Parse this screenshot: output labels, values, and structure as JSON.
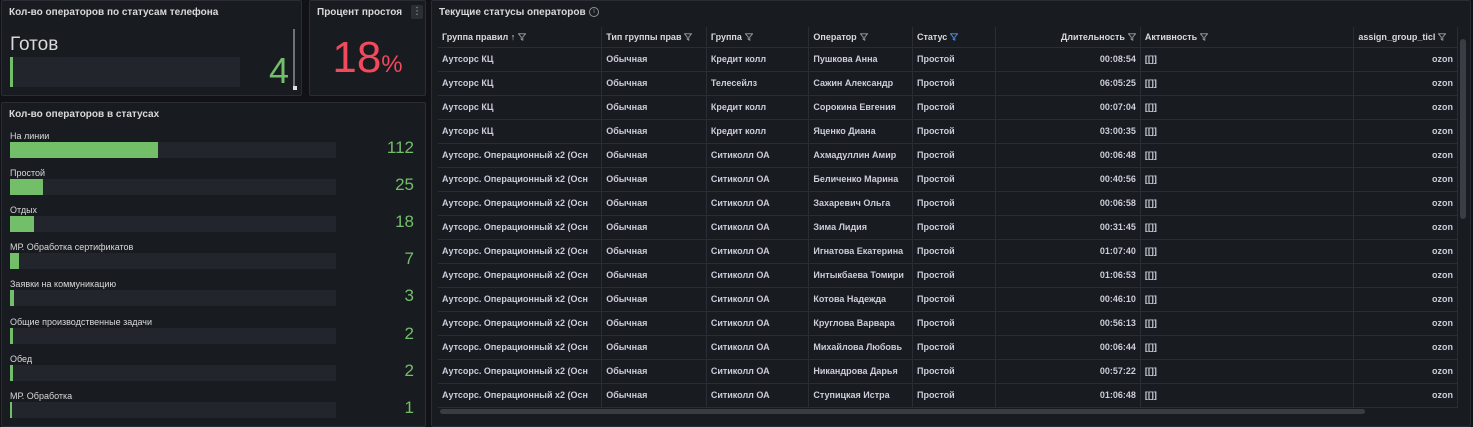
{
  "panel_phone_status": {
    "title": "Кол-во операторов по статусам телефона",
    "state": "Готов",
    "value": "4",
    "fill_fraction": 0.013
  },
  "panel_idle_percent": {
    "title": "Процент простоя",
    "value": "18",
    "unit": "%",
    "menu_icon": "⋮"
  },
  "panel_statuses": {
    "title": "Кол-во операторов в статусах",
    "max": 112,
    "items": [
      {
        "label": "На линии",
        "value": 112
      },
      {
        "label": "Простой",
        "value": 25
      },
      {
        "label": "Отдых",
        "value": 18
      },
      {
        "label": "МР. Обработка сертификатов",
        "value": 7
      },
      {
        "label": "Заявки на коммуникацию",
        "value": 3
      },
      {
        "label": "Общие производственные задачи",
        "value": 2
      },
      {
        "label": "Обед",
        "value": 2
      },
      {
        "label": "МР. Обработка",
        "value": 1
      }
    ]
  },
  "panel_table": {
    "title": "Текущие статусы операторов",
    "info_icon": "i",
    "sort_icon": "↑",
    "columns": [
      {
        "label": "Группа правил",
        "sorted": true
      },
      {
        "label": "Тип группы прав"
      },
      {
        "label": "Группа"
      },
      {
        "label": "Оператор"
      },
      {
        "label": "Статус",
        "filter_active": true
      },
      {
        "label": "Длительность"
      },
      {
        "label": "Активность"
      },
      {
        "label": "assign_group_ticl"
      }
    ],
    "rows": [
      [
        "Аутсорс КЦ",
        "Обычная",
        "Кредит колл",
        "Пушкова Анна",
        "Простой",
        "00:08:54",
        "[[]]",
        "ozon"
      ],
      [
        "Аутсорс КЦ",
        "Обычная",
        "Телесейлз",
        "Сажин Александр",
        "Простой",
        "06:05:25",
        "[[]]",
        "ozon"
      ],
      [
        "Аутсорс КЦ",
        "Обычная",
        "Кредит колл",
        "Сорокина Евгения",
        "Простой",
        "00:07:04",
        "[[]]",
        "ozon"
      ],
      [
        "Аутсорс КЦ",
        "Обычная",
        "Кредит колл",
        "Яценко Диана",
        "Простой",
        "03:00:35",
        "[[]]",
        "ozon"
      ],
      [
        "Аутсорс. Операционный x2 (Осн",
        "Обычная",
        "Ситиколл ОА",
        "Ахмадуллин Амир",
        "Простой",
        "00:06:48",
        "[[]]",
        "ozon"
      ],
      [
        "Аутсорс. Операционный x2 (Осн",
        "Обычная",
        "Ситиколл ОА",
        "Беличенко Марина",
        "Простой",
        "00:40:56",
        "[[]]",
        "ozon"
      ],
      [
        "Аутсорс. Операционный x2 (Осн",
        "Обычная",
        "Ситиколл ОА",
        "Захаревич Ольга",
        "Простой",
        "00:06:58",
        "[[]]",
        "ozon"
      ],
      [
        "Аутсорс. Операционный x2 (Осн",
        "Обычная",
        "Ситиколл ОА",
        "Зима Лидия",
        "Простой",
        "00:31:45",
        "[[]]",
        "ozon"
      ],
      [
        "Аутсорс. Операционный x2 (Осн",
        "Обычная",
        "Ситиколл ОА",
        "Игнатова Екатерина",
        "Простой",
        "01:07:40",
        "[[]]",
        "ozon"
      ],
      [
        "Аутсорс. Операционный x2 (Осн",
        "Обычная",
        "Ситиколл ОА",
        "Интыкбаева Томири",
        "Простой",
        "01:06:53",
        "[[]]",
        "ozon"
      ],
      [
        "Аутсорс. Операционный x2 (Осн",
        "Обычная",
        "Ситиколл ОА",
        "Котова Надежда",
        "Простой",
        "00:46:10",
        "[[]]",
        "ozon"
      ],
      [
        "Аутсорс. Операционный x2 (Осн",
        "Обычная",
        "Ситиколл ОА",
        "Круглова Варвара",
        "Простой",
        "00:56:13",
        "[[]]",
        "ozon"
      ],
      [
        "Аутсорс. Операционный x2 (Осн",
        "Обычная",
        "Ситиколл ОА",
        "Михайлова Любовь",
        "Простой",
        "00:06:44",
        "[[]]",
        "ozon"
      ],
      [
        "Аутсорс. Операционный x2 (Осн",
        "Обычная",
        "Ситиколл ОА",
        "Никандрова Дарья",
        "Простой",
        "00:57:22",
        "[[]]",
        "ozon"
      ],
      [
        "Аутсорс. Операционный x2 (Осн",
        "Обычная",
        "Ситиколл ОА",
        "Ступицкая Истра",
        "Простой",
        "01:06:48",
        "[[]]",
        "ozon"
      ]
    ]
  },
  "colors": {
    "background": "#111217",
    "panel": "#181b1f",
    "green": "#73bf69",
    "red": "#f2495c",
    "filter_active": "#5794f2"
  }
}
